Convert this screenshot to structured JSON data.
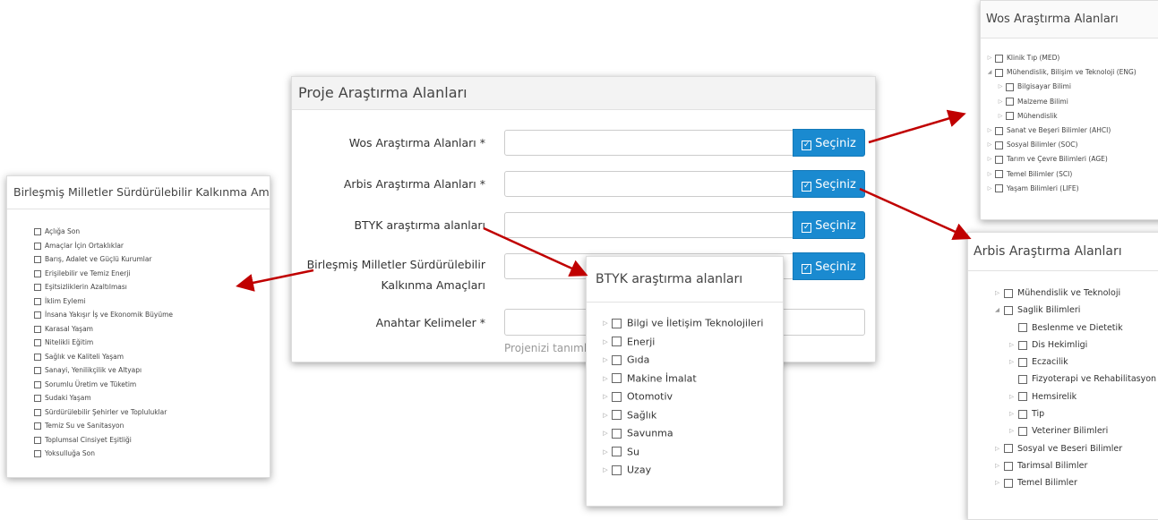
{
  "main_form": {
    "title": "Proje Araştırma Alanları",
    "select_label": "Seçiniz",
    "fields": [
      {
        "label": "Wos Araştırma Alanları *"
      },
      {
        "label": "Arbis Araştırma Alanları *"
      },
      {
        "label": "BTYK araştırma alanları"
      },
      {
        "label_line1": "Birleşmiş Milletler Sürdürülebilir",
        "label_line2": "Kalkınma Amaçları"
      },
      {
        "label": "Anahtar Kelimeler *"
      }
    ],
    "hint_text": "Projenizi tanımlay"
  },
  "sdg_panel": {
    "title": "Birleşmiş Milletler Sürdürülebilir Kalkınma Amaçları",
    "items": [
      "Açlığa Son",
      "Amaçlar İçin Ortaklıklar",
      "Barış, Adalet ve Güçlü Kurumlar",
      "Erişilebilir ve Temiz Enerji",
      "Eşitsizliklerin Azaltılması",
      "İklim Eylemi",
      "İnsana Yakışır İş ve Ekonomik Büyüme",
      "Karasal Yaşam",
      "Nitelikli Eğitim",
      "Sağlık ve Kaliteli Yaşam",
      "Sanayi, Yenilikçilik ve Altyapı",
      "Sorumlu Üretim ve Tüketim",
      "Sudaki Yaşam",
      "Sürdürülebilir Şehirler ve Topluluklar",
      "Temiz Su ve Sanitasyon",
      "Toplumsal Cinsiyet Eşitliği",
      "Yoksulluğa Son"
    ]
  },
  "btyk_panel": {
    "title": "BTYK araştırma alanları",
    "items": [
      "Bilgi ve İletişim Teknolojileri",
      "Enerji",
      "Gıda",
      "Makine İmalat",
      "Otomotiv",
      "Sağlık",
      "Savunma",
      "Su",
      "Uzay"
    ]
  },
  "wos_panel": {
    "title": "Wos Araştırma Alanları",
    "items": [
      {
        "label": "Klinik Tıp (MED)",
        "caret": "▷",
        "level": 0
      },
      {
        "label": "Mühendislik, Bilişim ve Teknoloji (ENG)",
        "caret": "◢",
        "level": 0
      },
      {
        "label": "Bilgisayar Bilimi",
        "caret": "▷",
        "level": 1
      },
      {
        "label": "Malzeme Bilimi",
        "caret": "▷",
        "level": 1
      },
      {
        "label": "Mühendislik",
        "caret": "▷",
        "level": 1
      },
      {
        "label": "Sanat ve Beşeri Bilimler (AHCI)",
        "caret": "▷",
        "level": 0
      },
      {
        "label": "Sosyal Bilimler (SOC)",
        "caret": "▷",
        "level": 0
      },
      {
        "label": "Tarım ve Çevre Bilimleri (AGE)",
        "caret": "▷",
        "level": 0
      },
      {
        "label": "Temel Bilimler (SCI)",
        "caret": "▷",
        "level": 0
      },
      {
        "label": "Yaşam Bilimleri (LIFE)",
        "caret": "▷",
        "level": 0
      }
    ]
  },
  "arbis_panel": {
    "title": "Arbis Araştırma Alanları",
    "items": [
      {
        "label": "Mühendislik ve Teknoloji",
        "caret": "▷",
        "level": 0
      },
      {
        "label": "Saglik Bilimleri",
        "caret": "◢",
        "level": 0
      },
      {
        "label": "Beslenme ve Dietetik",
        "caret": "",
        "level": 1
      },
      {
        "label": "Dis Hekimligi",
        "caret": "▷",
        "level": 1
      },
      {
        "label": "Eczacilik",
        "caret": "▷",
        "level": 1
      },
      {
        "label": "Fizyoterapi ve Rehabilitasyon",
        "caret": "",
        "level": 1
      },
      {
        "label": "Hemsirelik",
        "caret": "▷",
        "level": 1
      },
      {
        "label": "Tip",
        "caret": "▷",
        "level": 1
      },
      {
        "label": "Veteriner Bilimleri",
        "caret": "▷",
        "level": 1
      },
      {
        "label": "Sosyal ve Beseri Bilimler",
        "caret": "▷",
        "level": 0
      },
      {
        "label": "Tarimsal Bilimler",
        "caret": "▷",
        "level": 0
      },
      {
        "label": "Temel Bilimler",
        "caret": "▷",
        "level": 0
      }
    ]
  },
  "colors": {
    "button_blue": "#1a8ad0",
    "arrow_red": "#c00000"
  }
}
